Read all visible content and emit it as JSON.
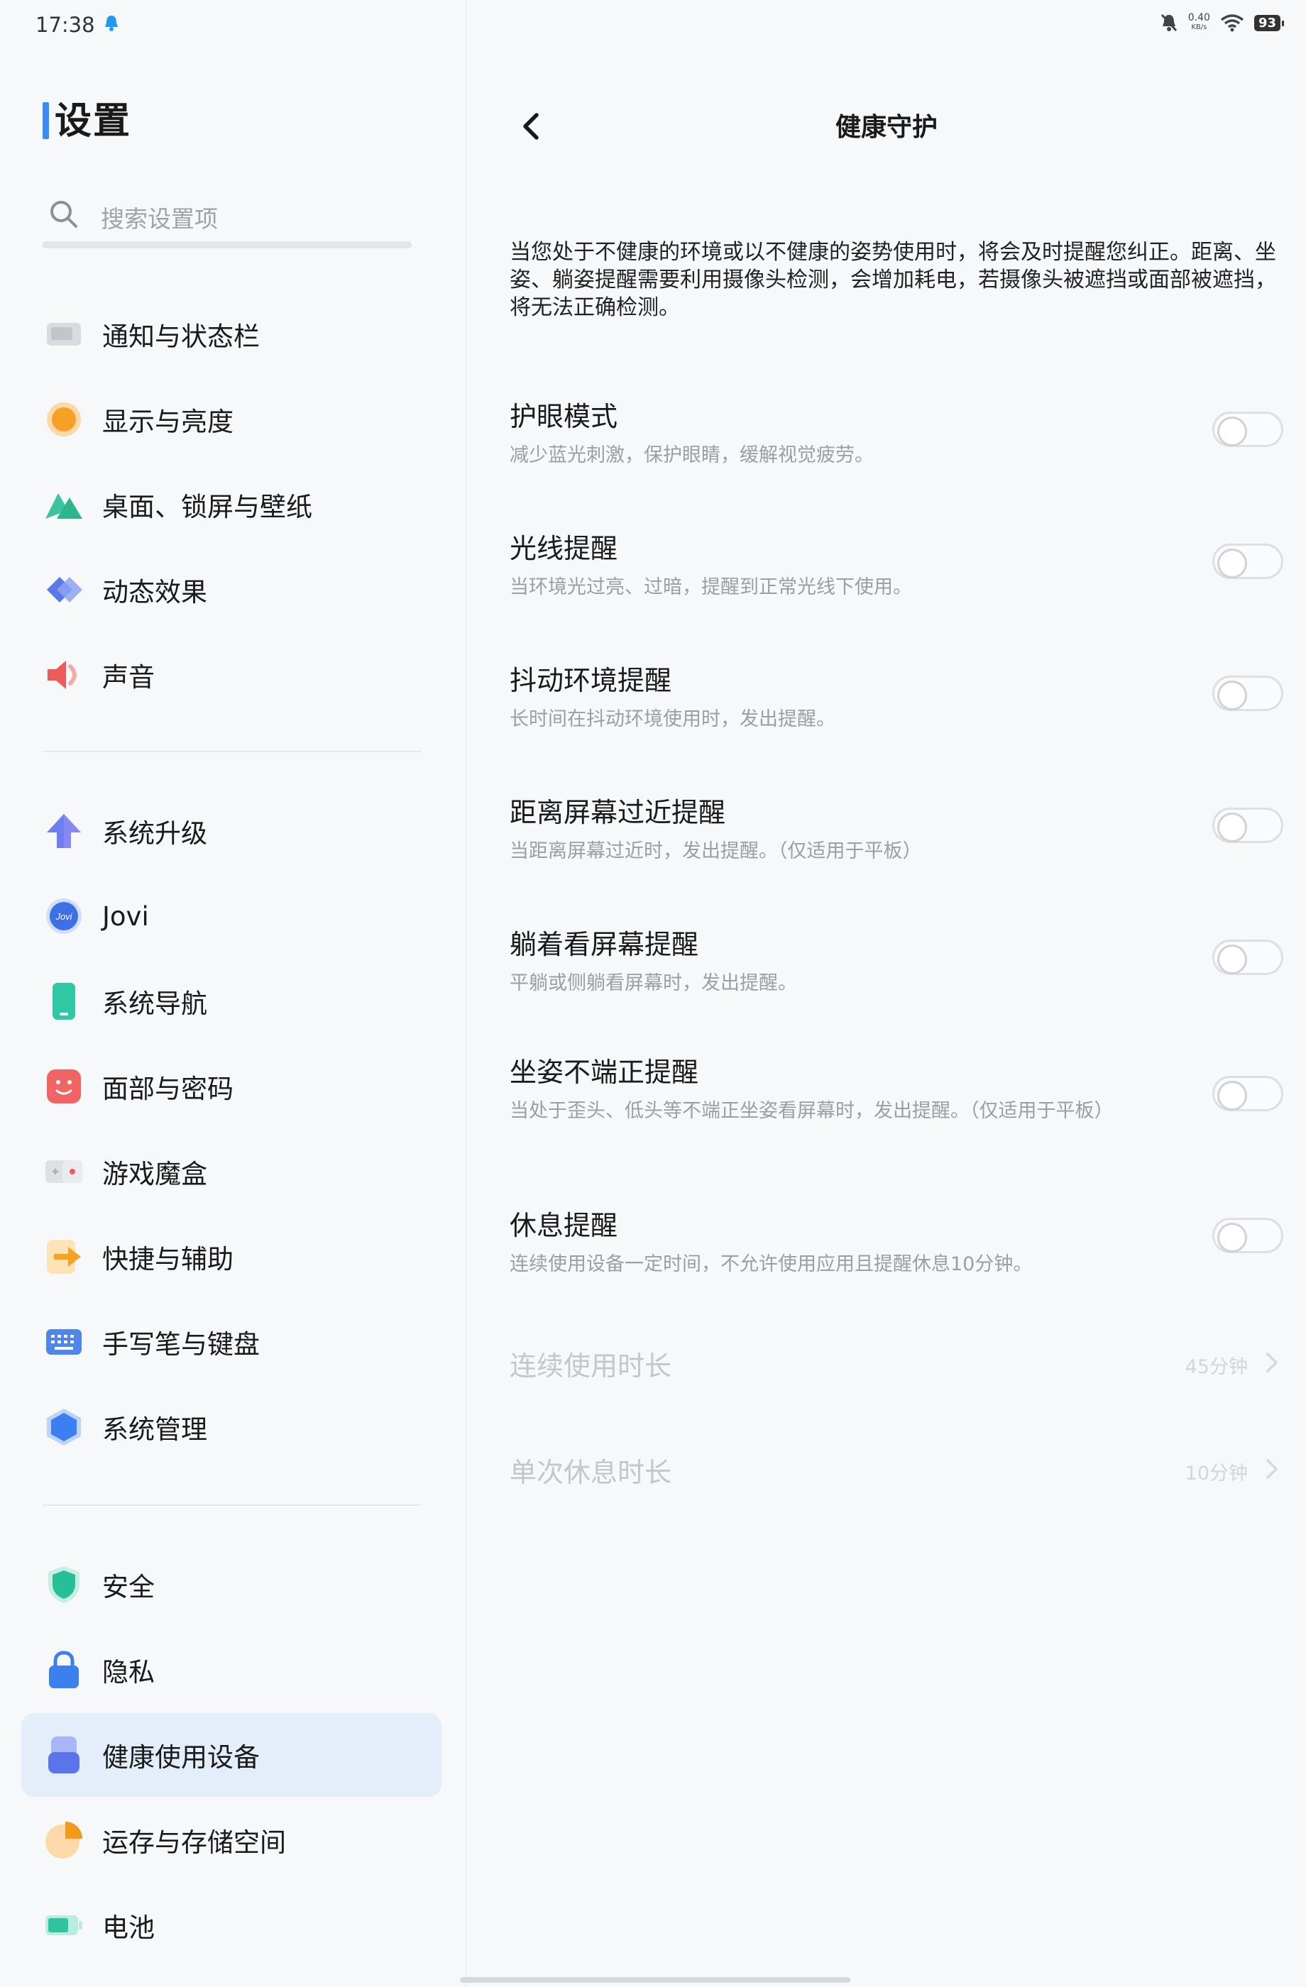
{
  "status": {
    "time": "17:38",
    "net_speed_value": "0.40",
    "net_speed_unit": "KB/s",
    "battery": "93"
  },
  "sidebar": {
    "title": "设置",
    "search_placeholder": "搜索设置项",
    "groups": [
      [
        {
          "label": "通知与状态栏",
          "icon": "notification-icon"
        },
        {
          "label": "显示与亮度",
          "icon": "brightness-icon"
        },
        {
          "label": "桌面、锁屏与壁纸",
          "icon": "wallpaper-icon"
        },
        {
          "label": "动态效果",
          "icon": "animation-icon"
        },
        {
          "label": "声音",
          "icon": "sound-icon"
        }
      ],
      [
        {
          "label": "系统升级",
          "icon": "upgrade-icon"
        },
        {
          "label": "Jovi",
          "icon": "jovi-icon"
        },
        {
          "label": "系统导航",
          "icon": "navigation-icon"
        },
        {
          "label": "面部与密码",
          "icon": "face-password-icon"
        },
        {
          "label": "游戏魔盒",
          "icon": "game-box-icon"
        },
        {
          "label": "快捷与辅助",
          "icon": "shortcut-icon"
        },
        {
          "label": "手写笔与键盘",
          "icon": "keyboard-icon"
        },
        {
          "label": "系统管理",
          "icon": "system-manage-icon"
        }
      ],
      [
        {
          "label": "安全",
          "icon": "security-icon"
        },
        {
          "label": "隐私",
          "icon": "privacy-icon"
        },
        {
          "label": "健康使用设备",
          "icon": "health-icon",
          "active": true
        },
        {
          "label": "运存与存储空间",
          "icon": "storage-icon"
        },
        {
          "label": "电池",
          "icon": "battery-icon"
        }
      ]
    ]
  },
  "detail": {
    "title": "健康守护",
    "intro": "当您处于不健康的环境或以不健康的姿势使用时，将会及时提醒您纠正。距离、坐姿、躺姿提醒需要利用摄像头检测，会增加耗电，若摄像头被遮挡或面部被遮挡，将无法正确检测。",
    "settings": [
      {
        "title": "护眼模式",
        "desc": "减少蓝光刺激，保护眼睛，缓解视觉疲劳。",
        "on": false
      },
      {
        "title": "光线提醒",
        "desc": "当环境光过亮、过暗，提醒到正常光线下使用。",
        "on": false
      },
      {
        "title": "抖动环境提醒",
        "desc": "长时间在抖动环境使用时，发出提醒。",
        "on": false
      },
      {
        "title": "距离屏幕过近提醒",
        "desc": "当距离屏幕过近时，发出提醒。（仅适用于平板）",
        "on": false
      },
      {
        "title": "躺着看屏幕提醒",
        "desc": "平躺或侧躺看屏幕时，发出提醒。",
        "on": false
      },
      {
        "title": "坐姿不端正提醒",
        "desc": "当处于歪头、低头等不端正坐姿看屏幕时，发出提醒。（仅适用于平板）",
        "on": false
      },
      {
        "title": "休息提醒",
        "desc": "连续使用设备一定时间，不允许使用应用且提醒休息10分钟。",
        "on": false
      }
    ],
    "durations": [
      {
        "title": "连续使用时长",
        "value": "45分钟"
      },
      {
        "title": "单次休息时长",
        "value": "10分钟"
      }
    ]
  }
}
